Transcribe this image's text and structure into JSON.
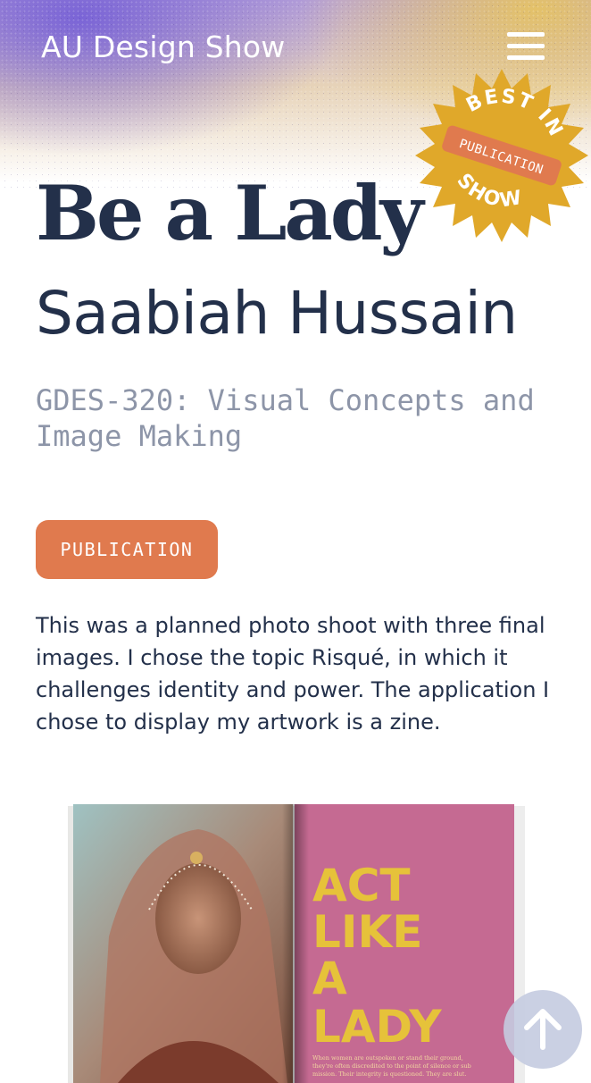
{
  "header": {
    "site_title": "AU Design Show",
    "menu_icon": "hamburger-menu-icon"
  },
  "award_badge": {
    "line_top": "BEST IN",
    "category": "PUBLICATION",
    "line_bottom": "SHOW",
    "colors": {
      "burst": "#e0a82a",
      "ribbon": "#e07a4e",
      "text": "#ffffff"
    }
  },
  "project": {
    "title": "Be a Lady",
    "author": "Saabiah Hussain",
    "course": "GDES-320: Visual Concepts and Image Making",
    "category_button": "PUBLICATION",
    "description": "This was a planned photo shoot with three final images. I chose the topic Risqué, in which it challenges identity and power. The application I chose to display my artwork is a zine."
  },
  "zine_image": {
    "headline_lines": [
      "ACT",
      "LIKE",
      "A",
      "LADY"
    ],
    "body_copy": "When women are outspoken or stand their ground, they're often discredited to the point of silence or submission. Their integrity is questioned. They are slut. Rude. They are angry. They are lying. They're a bitch."
  },
  "scroll_top": {
    "icon": "arrow-up-icon"
  },
  "colors": {
    "text_primary": "#23304a",
    "text_muted": "#8d95a8",
    "accent_orange": "#e07a4e",
    "header_purple": "#7660d6",
    "header_gold": "#e8c45c"
  }
}
